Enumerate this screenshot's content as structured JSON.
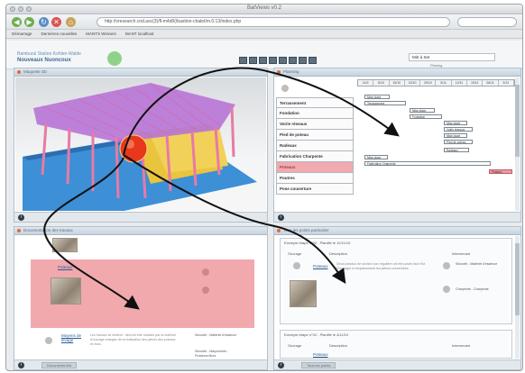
{
  "window": {
    "title": "BatViews v0.2"
  },
  "nav": {
    "url": "http://vresearch.cnd.asc(3)/fl-m4d0(/bastion-chalet/m.0.13/index.php",
    "buttons": [
      "back",
      "forward",
      "reload",
      "stop",
      "home"
    ]
  },
  "bookmarks": [
    "Démarrage",
    "Dernières nouvelles",
    "MANTS Winners",
    "MANT localhost"
  ],
  "header": {
    "project_label": "Bamburul Station Kohlen-Walde",
    "project_name": "Nouveaux Nuoncoux",
    "select_value": "Mitr à Set",
    "select_label": "Planing"
  },
  "panels": {
    "view3d": {
      "title": "Maquette 3D"
    },
    "planning": {
      "title": "Planning",
      "dates": [
        "11/9",
        "8/10",
        "15/10",
        "22/10",
        "29/10",
        "5/11",
        "12/11",
        "19/11",
        "26/11",
        "3/12"
      ],
      "tasks": [
        "Terrassement",
        "Fondation",
        "Voirie réseaux",
        "Pied de poteau",
        "Radeaux",
        "Fabrication Charpente",
        "Poteaux",
        "Poutres",
        "Pose couverture"
      ],
      "selected_task": "Poteaux",
      "bars": [
        "Mise place",
        "Terrassement",
        "Mise place",
        "Fondation",
        "Mise place",
        "Voirie réseaux",
        "Mise place",
        "Pied de poteau",
        "Radeaux",
        "Mise place",
        "Fabrication Charpente",
        "Poteaux"
      ]
    },
    "left_bottom": {
      "title": "Documentation des travaux",
      "footer": "Documents liés",
      "link1": "Poteaux",
      "link2": "Moyens de levage",
      "note": "Les travaux se limitent : devront être réalisés par la maîtrise d'ouvrage chargée de la réalisation des pièces des poteaux en bois.",
      "side1": "Sécurité - Matériel d'essence",
      "side2": "Sécurité - Maçonnerie - Fixations Murs"
    },
    "right_bottom": {
      "title": "Tous les points particulier",
      "footer": "Tous les points",
      "entry1": "Exemple étape n°02 - Planifié le 12/11/10",
      "entry2": "Exemple étape n°02 - Planifié le 4/11/10",
      "col_ouvrage": "Ouvrage",
      "col_description": "Description",
      "col_intervenant": "Intervenant",
      "link1": "Poteaux",
      "desc1": "Deux poteaux de section non régulière ont été posés face Est. S'engager à remplacement les pièces concernées.",
      "interv1": "Sécurité - Matériel d'essence",
      "interv1b": "Charpente - Charpente",
      "link2": "Poteaux"
    }
  },
  "colors": {
    "accent": "#3c6a95",
    "highlight": "#f1aab0",
    "marker": "#e8381b",
    "roof": "#b874d6"
  }
}
